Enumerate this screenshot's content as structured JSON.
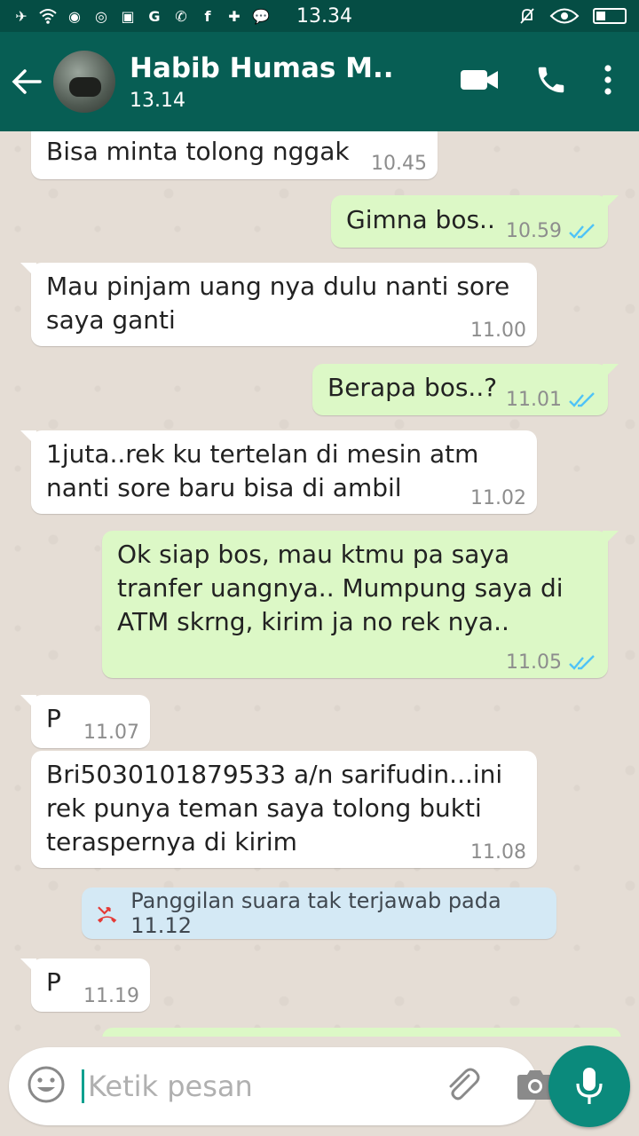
{
  "status_bar": {
    "time": "13.34"
  },
  "header": {
    "contact_name": "Habib Humas M...",
    "last_seen": "13.14"
  },
  "messages": [
    {
      "dir": "in",
      "text": "Bisa minta tolong nggak",
      "time": "10.45"
    },
    {
      "dir": "out",
      "text": "Gimna bos..",
      "time": "10.59"
    },
    {
      "dir": "in",
      "text": "Mau pinjam uang nya dulu nanti sore saya ganti",
      "time": "11.00"
    },
    {
      "dir": "out",
      "text": "Berapa bos..?",
      "time": "11.01"
    },
    {
      "dir": "in",
      "text": "1juta..rek ku tertelan di mesin atm nanti sore baru bisa di ambil",
      "time": "11.02"
    },
    {
      "dir": "out",
      "text": "Ok siap bos,  mau ktmu pa saya tranfer uangnya.. Mumpung saya di ATM skrng,  kirim ja no rek nya..",
      "time": "11.05"
    },
    {
      "dir": "in",
      "text": "P",
      "time": "11.07"
    },
    {
      "dir": "in",
      "text": "Bri5030101879533 a/n sarifudin...ini rek punya teman saya tolong bukti teraspernya di kirim",
      "time": "11.08"
    },
    {
      "dir": "in",
      "text": "P",
      "time": "11.19"
    }
  ],
  "missed_call": {
    "text": "Panggilan suara tak terjawab pada 11.12"
  },
  "composer": {
    "placeholder": "Ketik pesan"
  },
  "colors": {
    "header": "#075e54",
    "status_bar": "#054d44",
    "outgoing_bubble": "#dcf8c6",
    "incoming_bubble": "#ffffff",
    "read_ticks": "#4fc3f7",
    "mic_button": "#0b8a7c"
  },
  "icons": [
    "back-arrow-icon",
    "video-call-icon",
    "voice-call-icon",
    "more-options-icon",
    "double-check-icon",
    "missed-call-icon",
    "emoji-icon",
    "attachment-icon",
    "camera-icon",
    "microphone-icon"
  ]
}
